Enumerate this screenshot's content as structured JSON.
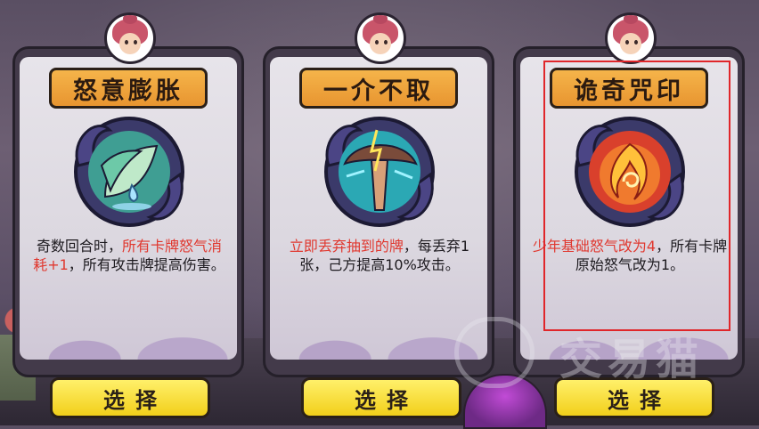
{
  "cards": [
    {
      "title": "怒意膨胀",
      "icon": "leaf-water-icon",
      "desc_parts": [
        {
          "text": "奇数回合时，",
          "hl": false
        },
        {
          "text": "所有卡牌怒气消耗+1",
          "hl": true
        },
        {
          "text": "，所有攻击牌提高伤害。",
          "hl": false
        }
      ],
      "select_label": "选择"
    },
    {
      "title": "一介不取",
      "icon": "lightning-hand-icon",
      "desc_parts": [
        {
          "text": "立即丢弃抽到的牌",
          "hl": true
        },
        {
          "text": "，每丢弃1张，己方提高10%攻击。",
          "hl": false
        }
      ],
      "select_label": "选择"
    },
    {
      "title": "诡奇咒印",
      "icon": "fire-orb-icon",
      "desc_parts": [
        {
          "text": "少年基础怒气改为4",
          "hl": true
        },
        {
          "text": "，所有卡牌原始怒气改为1。",
          "hl": false
        }
      ],
      "select_label": "选择"
    }
  ],
  "watermark": "交易猫",
  "colors": {
    "highlight": "#e0382f",
    "button": "#f2cf1a",
    "title_plate": "#e89530",
    "selection_border": "#e0262a"
  }
}
